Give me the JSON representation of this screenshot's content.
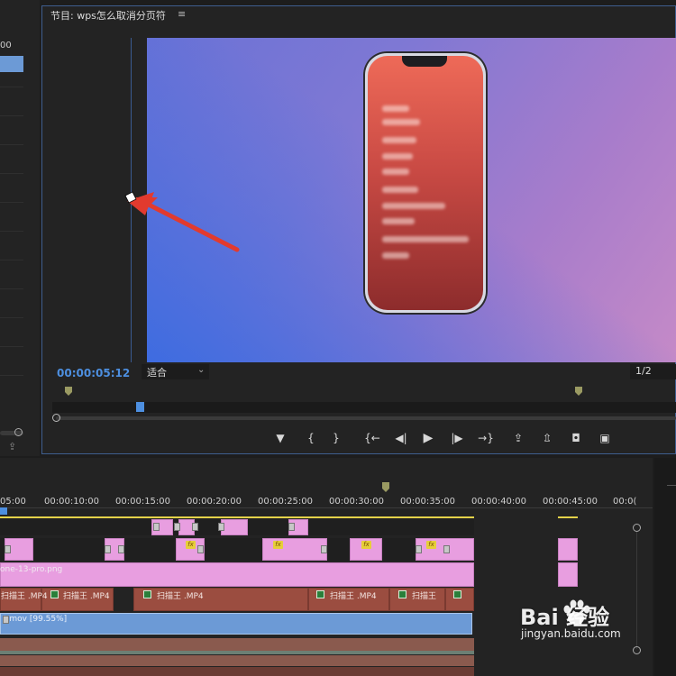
{
  "left_panel": {
    "value_fragment": "00"
  },
  "program_monitor": {
    "title": "节目: wps怎么取消分页符",
    "menu_icon": "hamburger-icon",
    "timecode": "00:00:05:12",
    "fit_select": "适合",
    "resolution_select": "1/2"
  },
  "transport_controls": [
    {
      "name": "add-marker-button",
      "icon": "marker-icon",
      "glyph": "▼"
    },
    {
      "name": "mark-in-button",
      "icon": "mark-in-icon",
      "glyph": "{"
    },
    {
      "name": "mark-out-button",
      "icon": "mark-out-icon",
      "glyph": "}"
    },
    {
      "name": "go-to-in-button",
      "icon": "go-to-in-icon",
      "glyph": "{←"
    },
    {
      "name": "step-back-button",
      "icon": "step-back-icon",
      "glyph": "◀|"
    },
    {
      "name": "play-button",
      "icon": "play-icon",
      "glyph": "▶"
    },
    {
      "name": "step-forward-button",
      "icon": "step-forward-icon",
      "glyph": "|▶"
    },
    {
      "name": "go-to-out-button",
      "icon": "go-to-out-icon",
      "glyph": "→}"
    },
    {
      "name": "lift-button",
      "icon": "lift-icon",
      "glyph": "⇪"
    },
    {
      "name": "extract-button",
      "icon": "extract-icon",
      "glyph": "⇫"
    },
    {
      "name": "export-frame-button",
      "icon": "camera-icon",
      "glyph": "◘"
    },
    {
      "name": "comparison-view-button",
      "icon": "compare-icon",
      "glyph": "▣"
    }
  ],
  "timeline": {
    "ruler_labels": [
      "05:00",
      "00:00:10:00",
      "00:00:15:00",
      "00:00:20:00",
      "00:00:25:00",
      "00:00:30:00",
      "00:00:35:00",
      "00:00:40:00",
      "00:00:45:00",
      "00:0("
    ],
    "png_clip_label": "one-13-pro.png",
    "mp4_clip_labels": [
      "扫描王 .MP4",
      "扫描王 .MP4",
      "扫描王 .MP4",
      "扫描王 .MP4",
      "扫描王"
    ],
    "fx_label": "fx",
    "mov_clip_label": "t.mov [99.55%]"
  },
  "watermark": {
    "logo_text": "Bai  经验",
    "url": "jingyan.baidu.com"
  },
  "colors": {
    "accent_blue": "#4d8fe0",
    "clip_pink": "#e89ee0",
    "clip_brown": "#9b4d40",
    "clip_blue": "#6c9ad6",
    "annotation_red": "#e23a2e"
  }
}
